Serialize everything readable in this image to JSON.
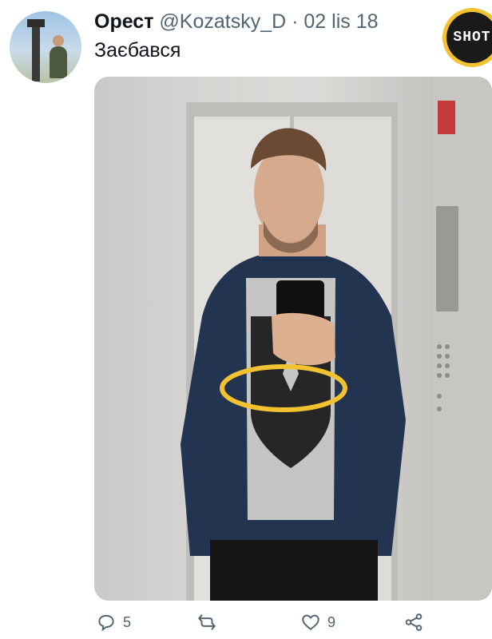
{
  "tweet": {
    "author_name": "Орест",
    "handle": "@Kozatsky_D",
    "separator": "·",
    "date": "02 lis 18",
    "text": "Заєбався"
  },
  "watermark": {
    "label": "SHOT"
  },
  "actions": {
    "reply": {
      "icon": "reply-icon",
      "count": "5"
    },
    "retweet": {
      "icon": "retweet-icon"
    },
    "like": {
      "icon": "heart-icon",
      "count": "9"
    },
    "share": {
      "icon": "share-icon"
    }
  },
  "colors": {
    "highlight_circle": "#f2c230",
    "secondary_text": "#536471",
    "elevator_indicator": "#c43a3a"
  }
}
